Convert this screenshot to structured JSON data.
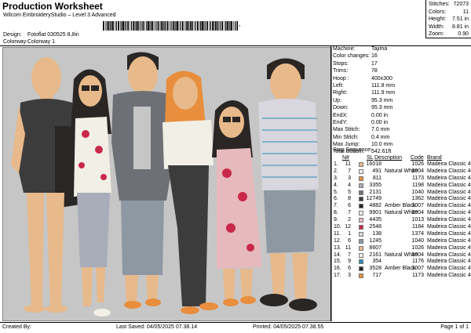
{
  "header": {
    "title": "Production Worksheet",
    "subtitle": "Wilcom EmbroideryStudio – Level 3 Advanced",
    "barcode_char": ","
  },
  "meta": {
    "design_label": "Design:",
    "design_value": "Fotoflat 030525 8,8in",
    "colorway_label": "Colorway:",
    "colorway_value": "Colorway 1"
  },
  "stats": [
    {
      "k": "Stitches:",
      "v": "72073"
    },
    {
      "k": "Colors:",
      "v": "11"
    },
    {
      "k": "Height:",
      "v": "7.51 in"
    },
    {
      "k": "Width:",
      "v": "8.81 in"
    },
    {
      "k": "Zoom:",
      "v": "0.90"
    }
  ],
  "machine_info": [
    {
      "k": "Machine:",
      "v": "Tajima"
    },
    {
      "k": "Color changes:",
      "v": "16"
    },
    {
      "k": "Stops:",
      "v": "17"
    },
    {
      "k": "Trims:",
      "v": "78"
    },
    {
      "k": "Hoop :",
      "v": "400x300"
    },
    {
      "k": "Left:",
      "v": "111.8 mm"
    },
    {
      "k": "Right:",
      "v": "111.9 mm"
    },
    {
      "k": "Up:",
      "v": "95.3 mm"
    },
    {
      "k": "Down:",
      "v": "95.3 mm"
    },
    {
      "k": "EndX:",
      "v": "0.00 in"
    },
    {
      "k": "EndY:",
      "v": "0.00 in"
    },
    {
      "k": "Max Stitch:",
      "v": "7.0 mm"
    },
    {
      "k": "Min Stitch:",
      "v": "0.4 mm"
    },
    {
      "k": "Max Jump:",
      "v": "10.0 mm"
    },
    {
      "k": "Total Bobbin:",
      "v": "542.61ft"
    }
  ],
  "stop_sequence": {
    "label": "Stop Sequence:",
    "headers": {
      "num": "N#",
      "sl": "SL",
      "desc": "Description",
      "code": "Code",
      "brand": "Brand"
    },
    "rows": [
      {
        "i": "1.",
        "n": "11",
        "color": "#e7b98b",
        "sl": "16018",
        "desc": "",
        "code": "1026",
        "brand": "Madeira Classic 40"
      },
      {
        "i": "2.",
        "n": "7",
        "color": "#f2efe6",
        "sl": "491",
        "desc": "Natural White",
        "code": "1004",
        "brand": "Madeira Classic 40"
      },
      {
        "i": "3.",
        "n": "3",
        "color": "#e88e3c",
        "sl": "811",
        "desc": "",
        "code": "1173",
        "brand": "Madeira Classic 40"
      },
      {
        "i": "4.",
        "n": "4",
        "color": "#a9acb9",
        "sl": "3355",
        "desc": "",
        "code": "1198",
        "brand": "Madeira Classic 40"
      },
      {
        "i": "5.",
        "n": "5",
        "color": "#6d7077",
        "sl": "2131",
        "desc": "",
        "code": "1040",
        "brand": "Madeira Classic 40"
      },
      {
        "i": "6.",
        "n": "8",
        "color": "#3c3c3c",
        "sl": "12749",
        "desc": "",
        "code": "1362",
        "brand": "Madeira Classic 40"
      },
      {
        "i": "7.",
        "n": "6",
        "color": "#2a2624",
        "sl": "4882",
        "desc": "Amber Black",
        "code": "1007",
        "brand": "Madeira Classic 40"
      },
      {
        "i": "8.",
        "n": "7",
        "color": "#f2efe6",
        "sl": "9901",
        "desc": "Natural White",
        "code": "1004",
        "brand": "Madeira Classic 40"
      },
      {
        "i": "9.",
        "n": "2",
        "color": "#e6b9bd",
        "sl": "4435",
        "desc": "",
        "code": "1013",
        "brand": "Madeira Classic 40"
      },
      {
        "i": "10.",
        "n": "12",
        "color": "#c9284a",
        "sl": "2548",
        "desc": "",
        "code": "1184",
        "brand": "Madeira Classic 40"
      },
      {
        "i": "11.",
        "n": "1",
        "color": "#d8d6de",
        "sl": "138",
        "desc": "",
        "code": "1374",
        "brand": "Madeira Classic 40"
      },
      {
        "i": "12.",
        "n": "6",
        "color": "#8e98a3",
        "sl": "1245",
        "desc": "",
        "code": "1040",
        "brand": "Madeira Classic 40"
      },
      {
        "i": "13.",
        "n": "11",
        "color": "#e7b98b",
        "sl": "8607",
        "desc": "",
        "code": "1026",
        "brand": "Madeira Classic 40"
      },
      {
        "i": "14.",
        "n": "7",
        "color": "#f2efe6",
        "sl": "2161",
        "desc": "Natural White",
        "code": "1004",
        "brand": "Madeira Classic 40"
      },
      {
        "i": "15.",
        "n": "9",
        "color": "#2e8fb5",
        "sl": "354",
        "desc": "",
        "code": "1176",
        "brand": "Madeira Classic 40"
      },
      {
        "i": "16.",
        "n": "6",
        "color": "#2a2624",
        "sl": "3528",
        "desc": "Amber Black",
        "code": "1007",
        "brand": "Madeira Classic 40"
      },
      {
        "i": "17.",
        "n": "3",
        "color": "#e88e3c",
        "sl": "717",
        "desc": "",
        "code": "1173",
        "brand": "Madeira Classic 40"
      }
    ]
  },
  "footer": {
    "created_by": "Created By:",
    "last_saved": "Last Saved: 04/05/2025 07.38.14",
    "printed": "Printed: 04/05/2025 07.38.55",
    "page": "Page 1 of 1"
  },
  "colors": {
    "skin": "#e7b98b",
    "hair": "#2a2624",
    "canvas": "#c6c6c6"
  }
}
